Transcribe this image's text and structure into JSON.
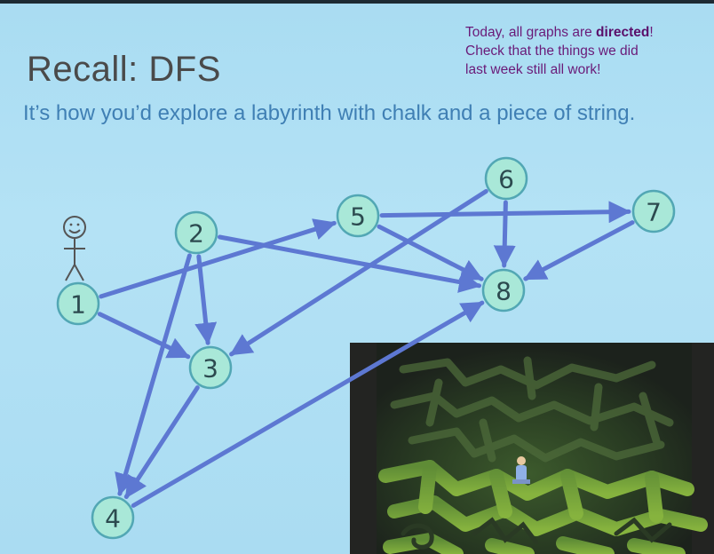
{
  "slide": {
    "title": "Recall: DFS",
    "subtitle": "It’s how you’d explore a labyrinth with chalk and a piece of string.",
    "note": {
      "line1_prefix": "Today, all graphs are ",
      "line1_bold": "directed",
      "line1_suffix": "!",
      "line2": "Check that the things we did",
      "line3": "last week still all work!"
    }
  },
  "graph": {
    "nodes": [
      {
        "id": "1",
        "label": "1"
      },
      {
        "id": "2",
        "label": "2"
      },
      {
        "id": "3",
        "label": "3"
      },
      {
        "id": "4",
        "label": "4"
      },
      {
        "id": "5",
        "label": "5"
      },
      {
        "id": "6",
        "label": "6"
      },
      {
        "id": "7",
        "label": "7"
      },
      {
        "id": "8",
        "label": "8"
      }
    ],
    "edges": [
      {
        "from": "1",
        "to": "5"
      },
      {
        "from": "1",
        "to": "3"
      },
      {
        "from": "2",
        "to": "3"
      },
      {
        "from": "2",
        "to": "4"
      },
      {
        "from": "2",
        "to": "8"
      },
      {
        "from": "3",
        "to": "4"
      },
      {
        "from": "4",
        "to": "8"
      },
      {
        "from": "5",
        "to": "7"
      },
      {
        "from": "5",
        "to": "8"
      },
      {
        "from": "6",
        "to": "3"
      },
      {
        "from": "6",
        "to": "8"
      },
      {
        "from": "7",
        "to": "8"
      }
    ],
    "start_marker": "stick-figure"
  },
  "colors": {
    "background": "#b0e0f4",
    "edge": "#5d78d2",
    "node_fill": "#a9e8d8",
    "note_text": "#6a1a78",
    "subtitle_text": "#3f7fb4"
  }
}
